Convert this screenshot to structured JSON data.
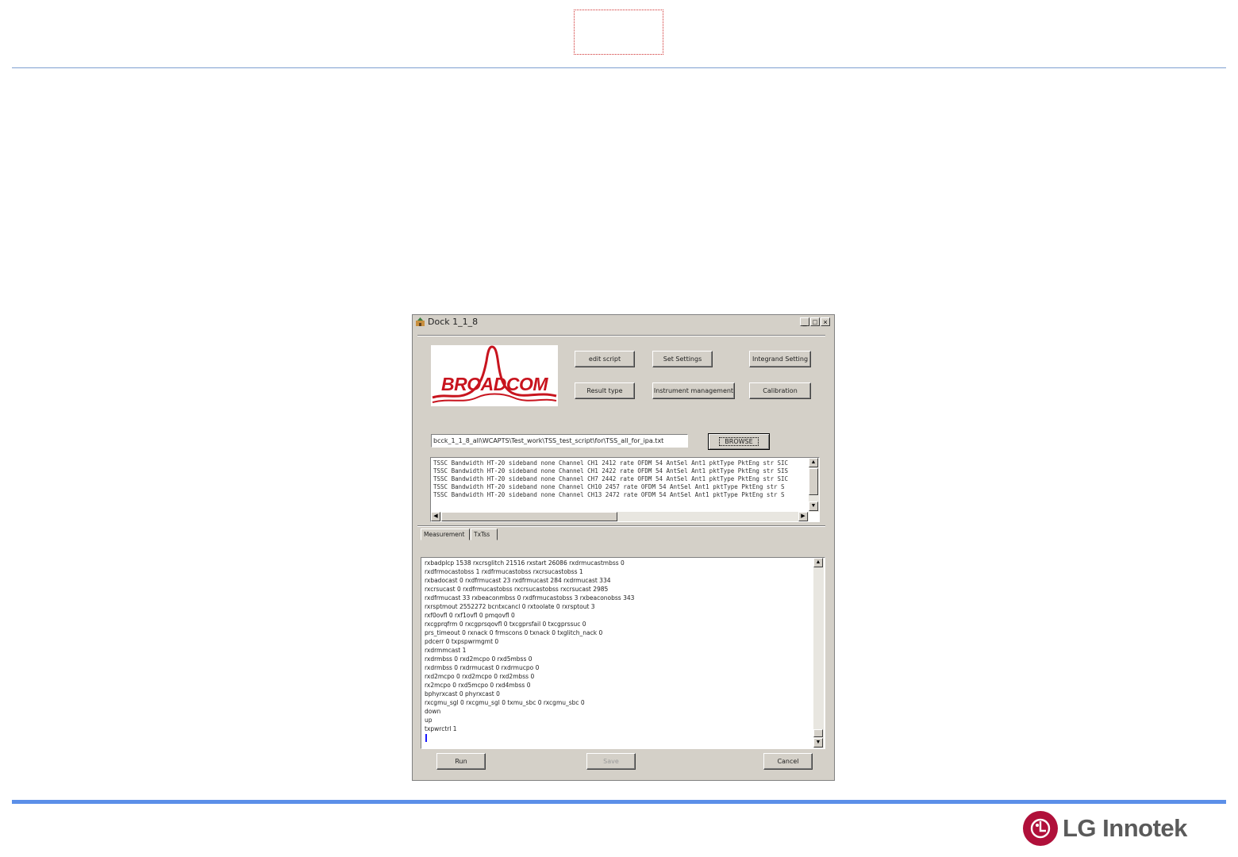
{
  "window": {
    "title": "Dock 1_1_8",
    "controls": {
      "minimize": "_",
      "maximize": "□",
      "close": "×"
    }
  },
  "toolbar": {
    "edit_script": "edit script",
    "set_settings": "Set Settings",
    "integrand_setting": "Integrand Setting",
    "result_type": "Result type",
    "instrument_management": "Instrument management",
    "calibration": "Calibration"
  },
  "logo": {
    "brand": "BROADCOM"
  },
  "script_path": {
    "value": "bcck_1_1_8_all\\WCAPTS\\Test_work\\TSS_test_script\\for\\TSS_all_for_ipa.txt",
    "browse_label": "BROWSE"
  },
  "script_lines": [
    "TSSC Bandwidth HT-20 sideband none Channel CH1 2412 rate OFDM 54 AntSel Ant1 pktType PktEng str SIC",
    "TSSC Bandwidth HT-20 sideband none Channel CH1 2422 rate OFDM 54 AntSel Ant1 pktType PktEng str SIS",
    "TSSC Bandwidth HT-20 sideband none Channel CH7 2442 rate OFDM 54 AntSel Ant1 pktType PktEng str SIC",
    "TSSC Bandwidth HT-20 sideband none Channel CH10 2457 rate OFDM 54 AntSel Ant1 pktType PktEng str S",
    "TSSC Bandwidth HT-20 sideband none Channel CH13 2472 rate OFDM 54 AntSel Ant1 pktType PktEng str S"
  ],
  "tabs": [
    {
      "label": "Measurement"
    },
    {
      "label": "TxTss"
    }
  ],
  "log_lines": [
    "rxbadplcp 1538 rxcrsglitch 21516 rxstart 26086 rxdrmucastmbss 0",
    "rxdfrmocastobss 1 rxdfrmucastobss rxcrsucastobss 1",
    "rxbadocast 0 rxdfrmucast 23 rxdfrmucast 284 rxdrmucast 334",
    "rxcrsucast 0 rxdfrmucastobss rxcrsucastobss rxcrsucast 2985",
    "rxdfrmucast 33 rxbeaconmbss 0 rxdfrmucastobss 3 rxbeaconobss 343",
    "rxrsptmout 2552272 bcntxcancl 0 rxtoolate 0 rxrsptout 3",
    "rxf0ovfl 0 rxf1ovfl 0 pmqovfl 0",
    "rxcgprqfrm 0 rxcgprsqovfl 0 txcgprsfail 0 txcgprssuc 0",
    "prs_timeout 0 rxnack 0 frmscons 0 txnack 0 txglitch_nack 0",
    "pdcerr 0 txpspwrmgmt 0",
    "rxdrmmcast 1",
    "rxdrmbss 0 rxd2mcpo 0 rxd5mbss 0",
    "rxdrmbss 0 rxdrmucast 0 rxdrmucpo 0",
    "rxd2mcpo 0 rxd2mcpo 0 rxd2mbss 0",
    "rx2mcpo 0 rxd5mcpo 0 rxd4mbss 0",
    "bphyrxcast 0 phyrxcast 0",
    "rxcgmu_sgl 0 rxcgmu_sgl 0 txmu_sbc 0 rxcgmu_sbc 0",
    "down",
    "up",
    "txpwrctrl 1"
  ],
  "actions": {
    "run": "Run",
    "save": "Save",
    "cancel": "Cancel"
  },
  "footer": {
    "company": "LG Innotek"
  },
  "colors": {
    "accent_line": "#5b8fe8",
    "broadcom_red": "#c8141e",
    "lg_red": "#b0103a"
  }
}
